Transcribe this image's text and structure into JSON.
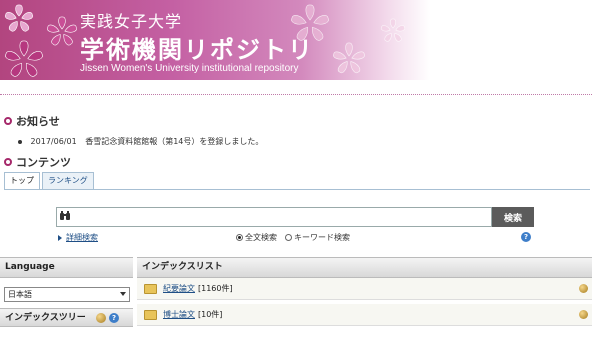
{
  "banner": {
    "title_jp": "実践女子大学",
    "title_main": "学術機関リポジトリ",
    "subtitle": "Jissen Women's University institutional repository"
  },
  "notice": {
    "heading": "お知らせ",
    "items": [
      {
        "date": "2017/06/01",
        "text": "香雪記念資料館館報（第14号）を登録しました。"
      }
    ]
  },
  "contents": {
    "heading": "コンテンツ",
    "tabs": [
      {
        "label": "トップ",
        "active": true
      },
      {
        "label": "ランキング",
        "active": false
      }
    ]
  },
  "search": {
    "input_value": "",
    "button_label": "検索",
    "advanced_label": "詳細検索",
    "options": [
      {
        "label": "全文検索",
        "selected": true
      },
      {
        "label": "キーワード検索",
        "selected": false
      }
    ],
    "help_icon": "?"
  },
  "sidebar": {
    "language_heading": "Language",
    "language_selected": "日本語",
    "tree_heading": "インデックスツリー",
    "tree_help": "?"
  },
  "index_list": {
    "heading": "インデックスリスト",
    "items": [
      {
        "label": "紀要論文",
        "count": "[1160件]"
      },
      {
        "label": "博士論文",
        "count": "[10件]"
      }
    ]
  },
  "colors": {
    "accent": "#a5286a",
    "banner": "#c460a3",
    "link": "#1f4f86"
  }
}
